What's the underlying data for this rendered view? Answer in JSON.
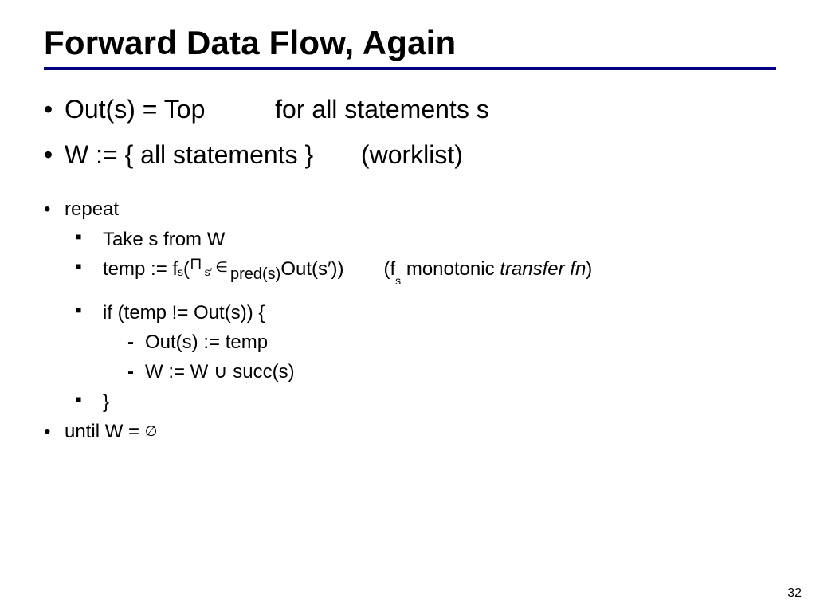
{
  "title": "Forward Data Flow, Again",
  "bullets": {
    "b1_left": "Out(s) = Top",
    "b1_right": "for all statements s",
    "b2_left": "W := { all statements }",
    "b2_right": "(worklist)"
  },
  "repeat": {
    "label": "repeat",
    "take": "Take s from W",
    "temp_prefix": "temp := f",
    "temp_sub1": "s",
    "temp_open": "(",
    "meet_glyph": "⊓",
    "temp_range_sub": "s′",
    "in_glyph": "∈",
    "pred": "pred(s)",
    "out_sprime": " Out(s′))",
    "fn_note_prefix": "(f",
    "fn_note_sub": "s",
    "fn_note_rest": " monotonic ",
    "fn_note_ital": "transfer fn",
    "fn_note_close": ")",
    "if_line": "if (temp != Out(s)) {",
    "assign_out": "Out(s) := temp",
    "assign_w_pre": "W := W ",
    "union_glyph": "∪",
    "assign_w_post": "  succ(s)",
    "close_brace": "}",
    "until_pre": "until W = ",
    "empty_glyph": "∅"
  },
  "slide_number": "32"
}
